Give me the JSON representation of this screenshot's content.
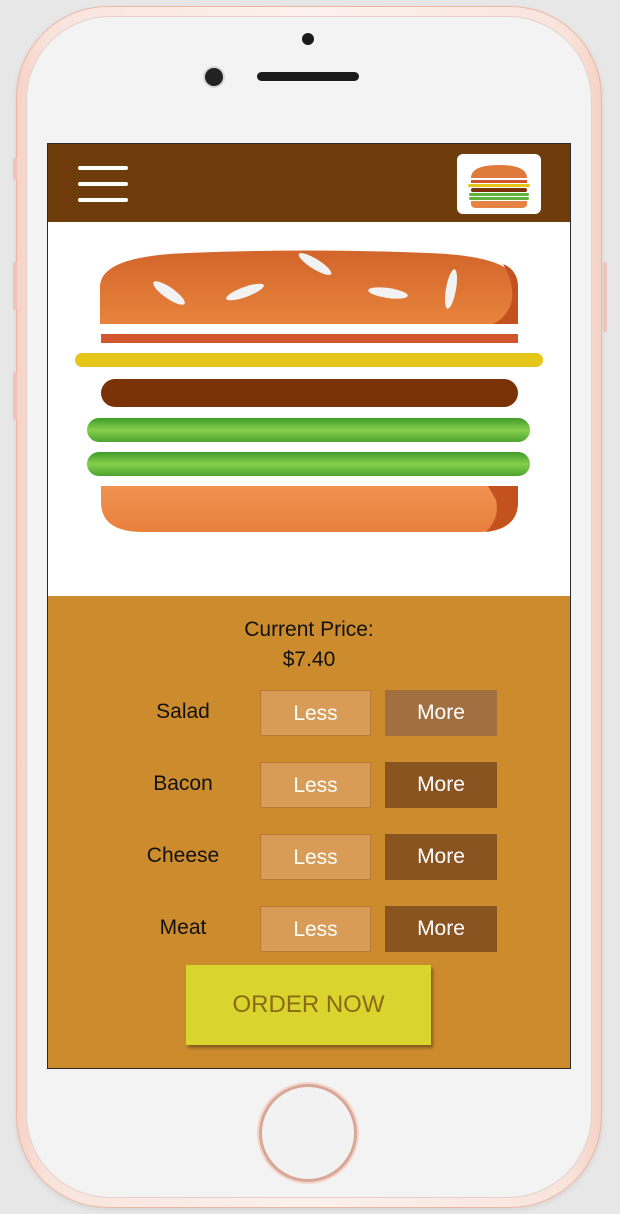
{
  "app": {
    "price_label": "Current Price:",
    "price_value": "$7.40",
    "order_label": "ORDER NOW"
  },
  "ingredients": [
    {
      "name": "Salad",
      "less_label": "Less",
      "more_label": "More"
    },
    {
      "name": "Bacon",
      "less_label": "Less",
      "more_label": "More"
    },
    {
      "name": "Cheese",
      "less_label": "Less",
      "more_label": "More"
    },
    {
      "name": "Meat",
      "less_label": "Less",
      "more_label": "More"
    }
  ],
  "icons": {
    "menu": "hamburger-menu-icon",
    "logo": "burger-logo-icon"
  },
  "colors": {
    "topbar": "#6e3d0b",
    "panel": "#cc8c2e",
    "less_button": "#d99c56",
    "more_button": "#8a5420",
    "more_button_hover": "#a27040",
    "order_button": "#d9d52e",
    "order_text": "#8a6a17",
    "bun": "#e07a3c",
    "cheese": "#e6c619",
    "meat": "#7a3306",
    "salad": "#5fb23a",
    "bacon": "#d1562e"
  }
}
